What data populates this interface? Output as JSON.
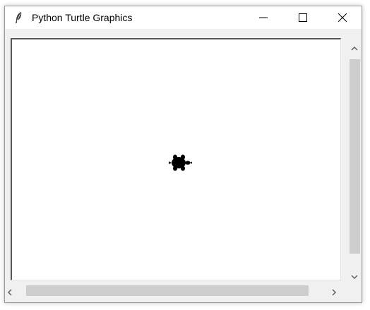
{
  "window": {
    "title": "Python Turtle Graphics",
    "app_icon": "feather-icon"
  },
  "controls": {
    "minimize": "minimize-icon",
    "maximize": "maximize-icon",
    "close": "close-icon"
  },
  "canvas": {
    "background": "#ffffff",
    "turtle_color": "#000000",
    "turtle_heading": "east"
  },
  "scrollbars": {
    "vertical": {
      "arrows": [
        "chevron-up-icon",
        "chevron-down-icon"
      ]
    },
    "horizontal": {
      "arrows": [
        "chevron-left-icon",
        "chevron-right-icon"
      ]
    }
  }
}
